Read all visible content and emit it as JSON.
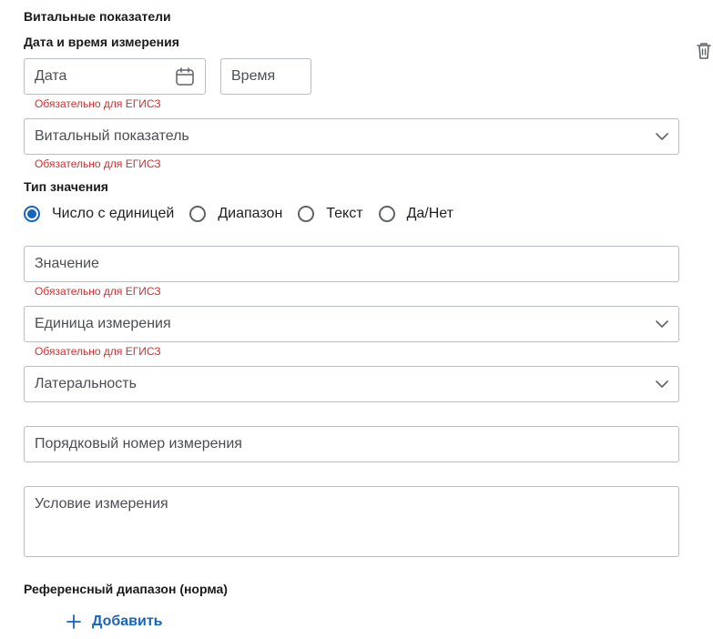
{
  "section_title": "Витальные показатели",
  "datetime": {
    "label": "Дата и время измерения",
    "date_placeholder": "Дата",
    "time_placeholder": "Время",
    "error": "Обязательно для ЕГИСЗ"
  },
  "vital": {
    "placeholder": "Витальный показатель",
    "error": "Обязательно для ЕГИСЗ"
  },
  "value_type": {
    "label": "Тип значения",
    "options": [
      {
        "label": "Число с единицей",
        "selected": true
      },
      {
        "label": "Диапазон",
        "selected": false
      },
      {
        "label": "Текст",
        "selected": false
      },
      {
        "label": "Да/Нет",
        "selected": false
      }
    ]
  },
  "value": {
    "placeholder": "Значение",
    "error": "Обязательно для ЕГИСЗ"
  },
  "unit": {
    "placeholder": "Единица измерения",
    "error": "Обязательно для ЕГИСЗ"
  },
  "laterality": {
    "placeholder": "Латеральность"
  },
  "order_number": {
    "placeholder": "Порядковый номер измерения"
  },
  "condition": {
    "placeholder": "Условие измерения"
  },
  "reference": {
    "label": "Референсный диапазон (норма)",
    "add_label": "Добавить"
  },
  "icons": {
    "delete": "trash-icon",
    "calendar": "calendar-icon",
    "dropdown": "chevron-down-icon",
    "add": "plus-icon"
  },
  "colors": {
    "accent": "#1565c0",
    "error": "#d32f2f",
    "border": "#b9bdc3"
  }
}
